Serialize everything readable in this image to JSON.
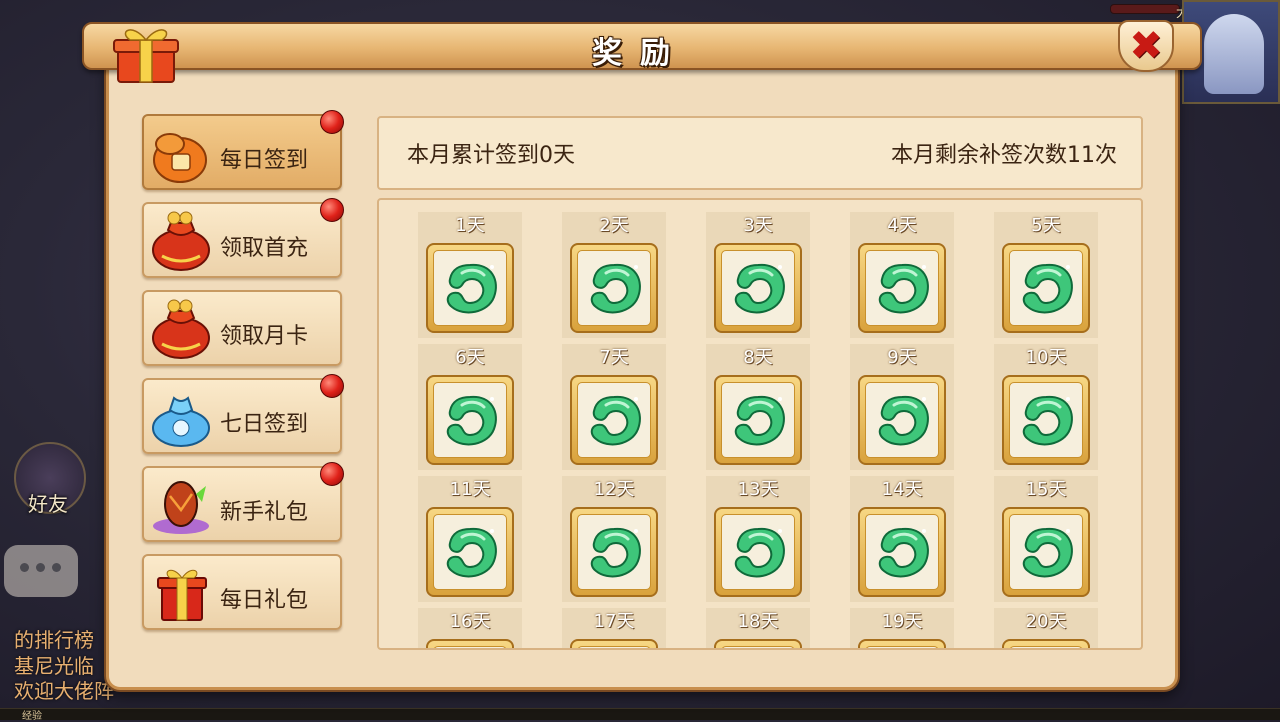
{
  "dialog": {
    "title": "奖励",
    "close_label": "✖"
  },
  "background": {
    "friend_label": "好友",
    "chat_lines": [
      "的排行榜",
      "基尼光临",
      "欢迎大佬阵"
    ],
    "bottom_label": "经验",
    "top_right_title": "大神"
  },
  "nav": {
    "items": [
      {
        "label": "每日签到",
        "icon": "lucky-bag-icon",
        "badge": true,
        "active": true
      },
      {
        "label": "领取首充",
        "icon": "money-bag-icon",
        "badge": true,
        "active": false
      },
      {
        "label": "领取月卡",
        "icon": "money-bag-icon",
        "badge": false,
        "active": false
      },
      {
        "label": "七日签到",
        "icon": "blue-bag-icon",
        "badge": true,
        "active": false
      },
      {
        "label": "新手礼包",
        "icon": "crystal-egg-icon",
        "badge": true,
        "active": false
      },
      {
        "label": "每日礼包",
        "icon": "gift-box-icon",
        "badge": false,
        "active": false
      }
    ]
  },
  "summary": {
    "left_text": "本月累计签到0天",
    "right_text": "本月剩余补签次数11次"
  },
  "signin": {
    "days": [
      "1天",
      "2天",
      "3天",
      "4天",
      "5天",
      "6天",
      "7天",
      "8天",
      "9天",
      "10天",
      "11天",
      "12天",
      "13天",
      "14天",
      "15天",
      "16天",
      "17天",
      "18天",
      "19天",
      "20天"
    ],
    "reward_icon": "jade-pendant-icon"
  },
  "colors": {
    "panel": "#f1dcbc",
    "border": "#c88f4e",
    "badge": "#e0221a",
    "close": "#c81a14"
  }
}
